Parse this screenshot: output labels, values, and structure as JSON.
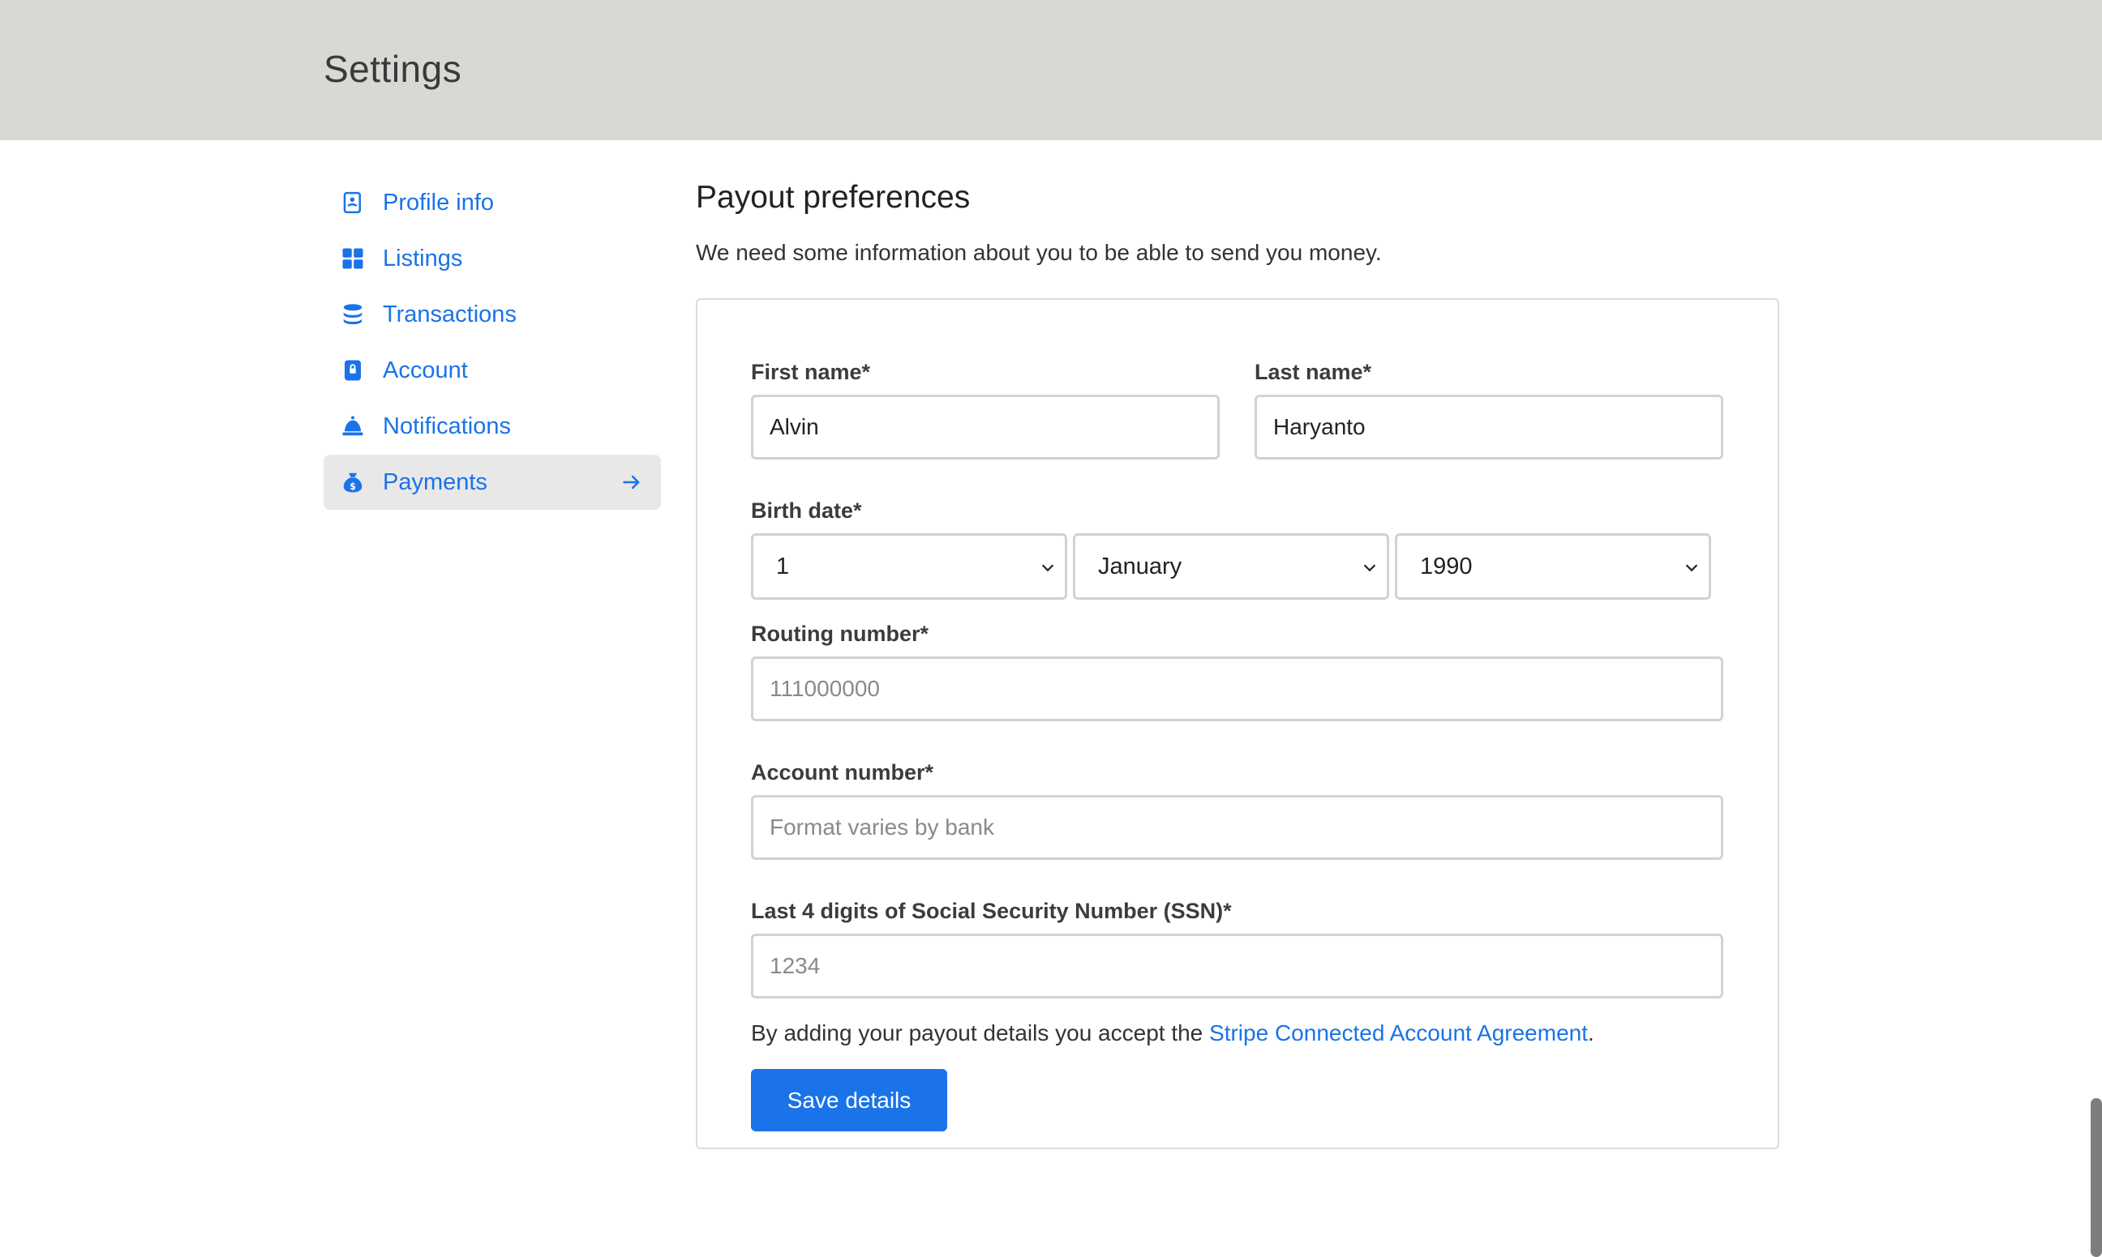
{
  "header": {
    "title": "Settings"
  },
  "sidebar": {
    "items": [
      {
        "label": "Profile info",
        "icon": "profile-card-icon"
      },
      {
        "label": "Listings",
        "icon": "grid-icon"
      },
      {
        "label": "Transactions",
        "icon": "coin-stack-icon"
      },
      {
        "label": "Account",
        "icon": "lock-icon"
      },
      {
        "label": "Notifications",
        "icon": "bell-icon"
      },
      {
        "label": "Payments",
        "icon": "money-bag-icon",
        "active": true
      }
    ]
  },
  "main": {
    "title": "Payout preferences",
    "intro": "We need some information about you to be able to send you money."
  },
  "form": {
    "first_name": {
      "label": "First name*",
      "value": "Alvin"
    },
    "last_name": {
      "label": "Last name*",
      "value": "Haryanto"
    },
    "birth_date": {
      "label": "Birth date*",
      "day": "1",
      "month": "January",
      "year": "1990"
    },
    "routing": {
      "label": "Routing number*",
      "placeholder": "111000000"
    },
    "account": {
      "label": "Account number*",
      "placeholder": "Format varies by bank"
    },
    "ssn": {
      "label": "Last 4 digits of Social Security Number (SSN)*",
      "placeholder": "1234"
    },
    "agreement_prefix": "By adding your payout details you accept the ",
    "agreement_link": "Stripe Connected Account Agreement",
    "agreement_suffix": ".",
    "save_label": "Save details"
  },
  "colors": {
    "accent": "#1a73e8",
    "header_bg": "#d8d8d5"
  }
}
